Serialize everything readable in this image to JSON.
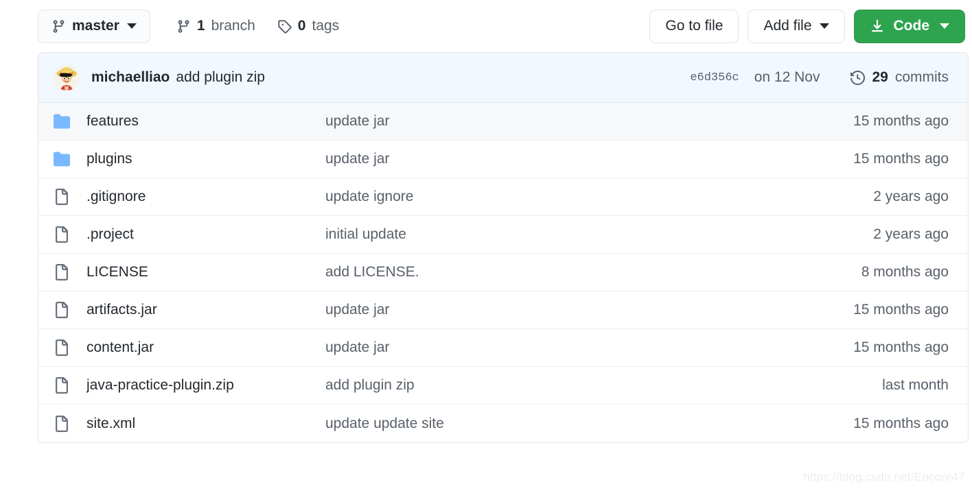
{
  "toolbar": {
    "branch_button": {
      "label": "master",
      "icon": "git-branch-icon"
    },
    "branch_count": {
      "value": "1",
      "label": "branch",
      "icon": "git-branch-icon"
    },
    "tag_count": {
      "value": "0",
      "label": "tags",
      "icon": "tag-icon"
    },
    "go_to_file": "Go to file",
    "add_file": "Add file",
    "code": "Code"
  },
  "commit": {
    "author": "michaelliao",
    "message": "add plugin zip",
    "sha": "e6d356c",
    "date": "on 12 Nov",
    "commits_number": "29",
    "commits_label": "commits",
    "avatar_alt": "michaelliao-avatar"
  },
  "files": [
    {
      "name": "features",
      "type": "folder",
      "message": "update jar",
      "age": "15 months ago",
      "shaded": true
    },
    {
      "name": "plugins",
      "type": "folder",
      "message": "update jar",
      "age": "15 months ago",
      "shaded": false
    },
    {
      "name": ".gitignore",
      "type": "file",
      "message": "update ignore",
      "age": "2 years ago",
      "shaded": false
    },
    {
      "name": ".project",
      "type": "file",
      "message": "initial update",
      "age": "2 years ago",
      "shaded": false
    },
    {
      "name": "LICENSE",
      "type": "file",
      "message": "add LICENSE.",
      "age": "8 months ago",
      "shaded": false
    },
    {
      "name": "artifacts.jar",
      "type": "file",
      "message": "update jar",
      "age": "15 months ago",
      "shaded": false
    },
    {
      "name": "content.jar",
      "type": "file",
      "message": "update jar",
      "age": "15 months ago",
      "shaded": false
    },
    {
      "name": "java-practice-plugin.zip",
      "type": "file",
      "message": "add plugin zip",
      "age": "last month",
      "shaded": false
    },
    {
      "name": "site.xml",
      "type": "file",
      "message": "update update site",
      "age": "15 months ago",
      "shaded": false
    }
  ],
  "watermark": "https://blog.csdn.net/Encore47",
  "colors": {
    "accent_green": "#2ea44f",
    "commit_bar_bg": "#f1f8ff",
    "folder_blue": "#79b8ff",
    "muted_text": "#586069",
    "border": "#e1e4e8"
  }
}
